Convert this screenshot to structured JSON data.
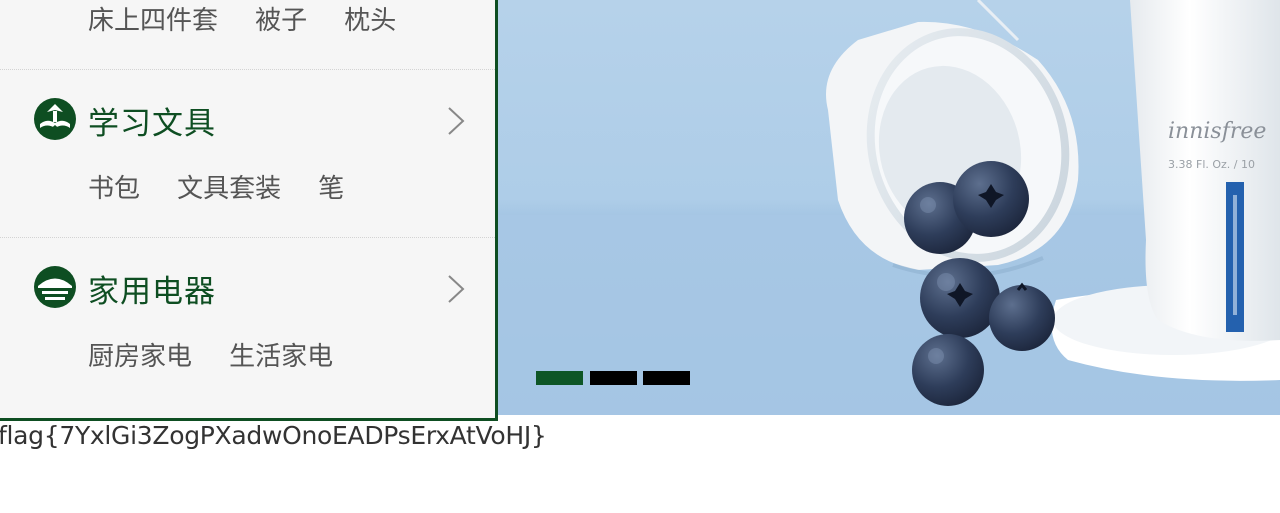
{
  "categories": {
    "partial_top": {
      "links": [
        "床上四件套",
        "被子",
        "枕头"
      ]
    },
    "items": [
      {
        "title": "学习文具",
        "icon": "stationery-icon",
        "links": [
          "书包",
          "文具套装",
          "笔"
        ]
      },
      {
        "title": "家用电器",
        "icon": "appliance-icon",
        "links": [
          "厨房家电",
          "生活家电"
        ]
      }
    ]
  },
  "banner": {
    "product_brand": "innisfree",
    "product_size": "3.38 Fl. Oz. / 10",
    "slides_total": 3,
    "active_slide": 1
  },
  "flag_text": "flag{7YxlGi3ZogPXadwOnoEADPsErxAtVoHJ}",
  "colors": {
    "accent_green": "#0e4e22",
    "sidebar_bg": "#f6f6f6",
    "link_gray": "#555555",
    "dot_inactive": "#000000"
  }
}
